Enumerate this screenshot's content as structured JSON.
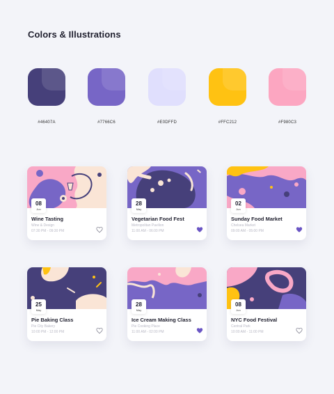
{
  "header": {
    "title": "Colors & Illustrations"
  },
  "palette": [
    {
      "hex": "#46407A",
      "color": "#46407a"
    },
    {
      "hex": "#7766C6",
      "color": "#7766c6"
    },
    {
      "hex": "#E0DFFD",
      "color": "#e0dffd"
    },
    {
      "hex": "#FFC212",
      "color": "#ffc212"
    },
    {
      "hex": "#F980C3",
      "color": "#fca6c1"
    }
  ],
  "cards": [
    {
      "day": "08",
      "month": "Jun",
      "title": "Wine Tasting",
      "venue": "Wine & Design",
      "time": "07:30 PM - 09:30 PM",
      "liked": false,
      "heart_icon": "heart-outline-icon"
    },
    {
      "day": "28",
      "month": "May",
      "title": "Vegetarian Food Fest",
      "venue": "Metropolitan Pavilion",
      "time": "11:00 AM - 06:00 PM",
      "liked": true,
      "heart_icon": "heart-filled-icon"
    },
    {
      "day": "02",
      "month": "Jun",
      "title": "Sunday Food Market",
      "venue": "Chelsea Market",
      "time": "09:00 AM - 05:00 PM",
      "liked": true,
      "heart_icon": "heart-filled-icon"
    },
    {
      "day": "25",
      "month": "May",
      "title": "Pie Baking Class",
      "venue": "Pie City Bakery",
      "time": "10:00 PM - 12:00 PM",
      "liked": false,
      "heart_icon": "heart-outline-icon"
    },
    {
      "day": "28",
      "month": "May",
      "title": "Ice Cream Making Class",
      "venue": "Pie Cooking Place",
      "time": "11:00 AM - 02:00 PM",
      "liked": true,
      "heart_icon": "heart-filled-icon"
    },
    {
      "day": "08",
      "month": "Jun",
      "title": "NYC Food Festival",
      "venue": "Central Park",
      "time": "10:00 AM - 11:00 PM",
      "liked": false,
      "heart_icon": "heart-outline-icon"
    }
  ]
}
